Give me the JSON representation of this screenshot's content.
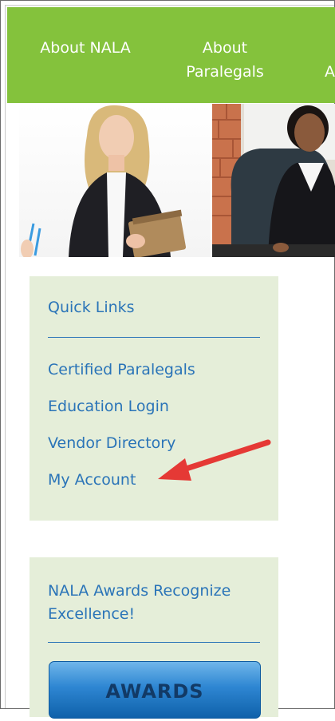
{
  "nav": {
    "items": [
      {
        "line1": "About NALA",
        "line2": ""
      },
      {
        "line1": "About",
        "line2": "Paralegals"
      },
      {
        "line1": "",
        "line2": "A"
      }
    ]
  },
  "quick_links": {
    "heading": "Quick Links",
    "items": [
      "Certified Paralegals",
      "Education Login",
      "Vendor Directory",
      "My Account"
    ]
  },
  "awards_box": {
    "heading": "NALA Awards Recognize Excellence!",
    "button_label": "AWARDS"
  },
  "colors": {
    "nav_green": "#84c23c",
    "link_blue": "#2a74b8",
    "box_bg": "#e5eed9",
    "arrow_red": "#e53935"
  }
}
